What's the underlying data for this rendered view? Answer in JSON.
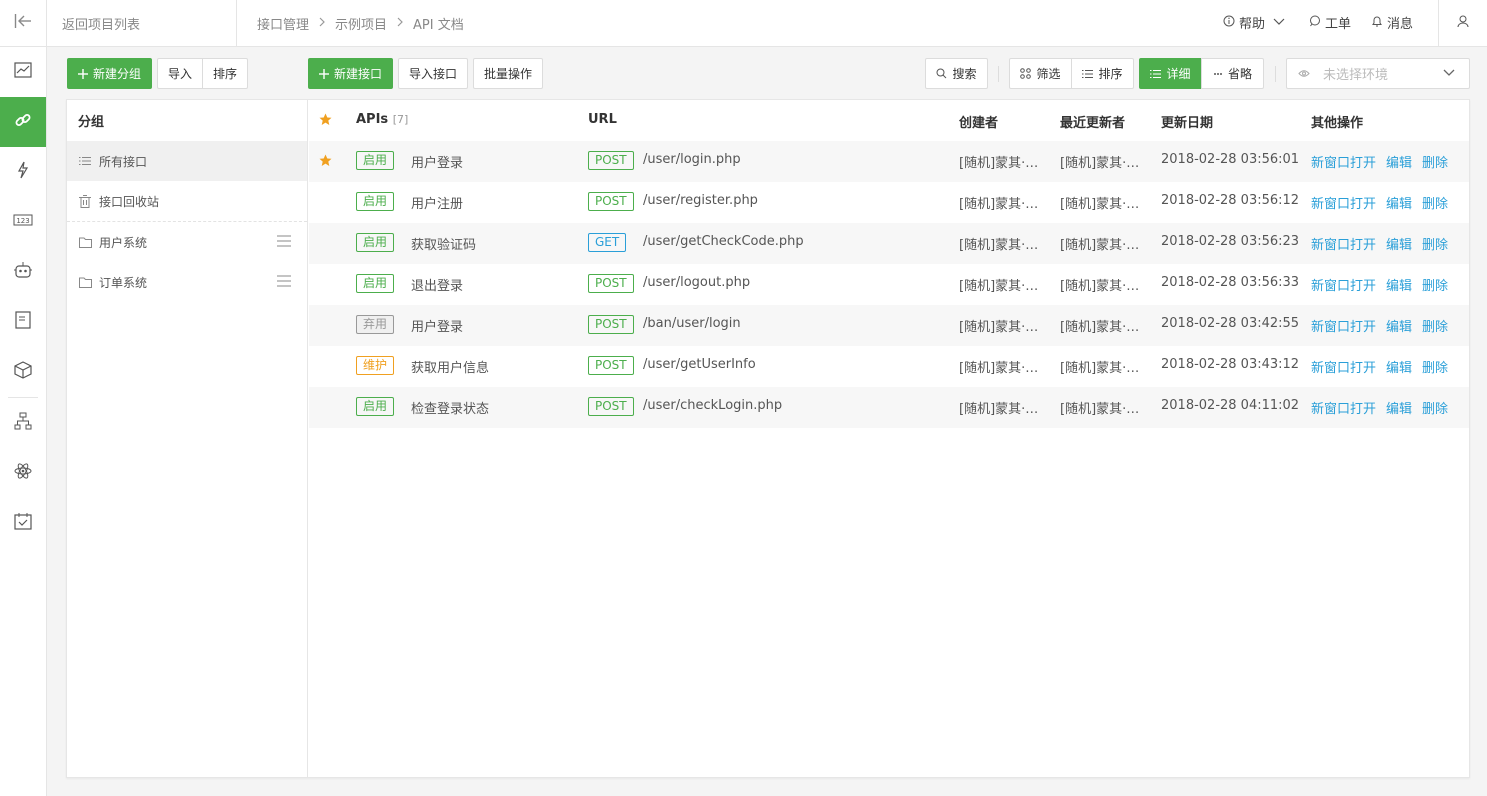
{
  "topbar": {
    "back_text": "返回项目列表",
    "breadcrumb": [
      "接口管理",
      "示例项目",
      "API 文档"
    ],
    "help": "帮助",
    "ticket": "工单",
    "messages": "消息"
  },
  "toolbar": {
    "new_group": "新建分组",
    "import": "导入",
    "sort": "排序",
    "new_api": "新建接口",
    "import_api": "导入接口",
    "batch": "批量操作",
    "search": "搜索",
    "filter": "筛选",
    "sort2": "排序",
    "detail": "详细",
    "brief": "省略",
    "env_placeholder": "未选择环境"
  },
  "groups": {
    "header": "分组",
    "items": [
      {
        "label": "所有接口",
        "icon": "list-icon"
      },
      {
        "label": "接口回收站",
        "icon": "trash-icon"
      },
      {
        "label": "用户系统",
        "icon": "folder-icon"
      },
      {
        "label": "订单系统",
        "icon": "folder-icon"
      }
    ]
  },
  "table": {
    "headers": {
      "apis": "APIs",
      "count": "[7]",
      "url": "URL",
      "creator": "创建者",
      "updater": "最近更新者",
      "date": "更新日期",
      "ops": "其他操作"
    },
    "ops_labels": {
      "open": "新窗口打开",
      "edit": "编辑",
      "delete": "删除"
    },
    "rows": [
      {
        "starred": true,
        "status": "启用",
        "status_type": "on",
        "name": "用户登录",
        "method": "POST",
        "url": "/user/login.php",
        "creator": "[随机]蒙其·D·路飞",
        "updater": "[随机]蒙其·D·路飞",
        "date": "2018-02-28 03:56:01"
      },
      {
        "starred": false,
        "status": "启用",
        "status_type": "on",
        "name": "用户注册",
        "method": "POST",
        "url": "/user/register.php",
        "creator": "[随机]蒙其·D·路飞",
        "updater": "[随机]蒙其·D·路飞",
        "date": "2018-02-28 03:56:12"
      },
      {
        "starred": false,
        "status": "启用",
        "status_type": "on",
        "name": "获取验证码",
        "method": "GET",
        "url": "/user/getCheckCode.php",
        "creator": "[随机]蒙其·D·路飞",
        "updater": "[随机]蒙其·D·路飞",
        "date": "2018-02-28 03:56:23"
      },
      {
        "starred": false,
        "status": "启用",
        "status_type": "on",
        "name": "退出登录",
        "method": "POST",
        "url": "/user/logout.php",
        "creator": "[随机]蒙其·D·路飞",
        "updater": "[随机]蒙其·D·路飞",
        "date": "2018-02-28 03:56:33"
      },
      {
        "starred": false,
        "status": "弃用",
        "status_type": "off",
        "name": "用户登录",
        "method": "POST",
        "url": "/ban/user/login",
        "creator": "[随机]蒙其·D·路飞",
        "updater": "[随机]蒙其·D·路飞",
        "date": "2018-02-28 03:42:55"
      },
      {
        "starred": false,
        "status": "维护",
        "status_type": "maint",
        "name": "获取用户信息",
        "method": "POST",
        "url": "/user/getUserInfo",
        "creator": "[随机]蒙其·D·路飞",
        "updater": "[随机]蒙其·D·路飞",
        "date": "2018-02-28 03:43:12"
      },
      {
        "starred": false,
        "status": "启用",
        "status_type": "on",
        "name": "检查登录状态",
        "method": "POST",
        "url": "/user/checkLogin.php",
        "creator": "[随机]蒙其·D·路飞",
        "updater": "[随机]蒙其·D·路飞",
        "date": "2018-02-28 04:11:02"
      }
    ]
  },
  "colors": {
    "accent": "#4cae4c",
    "link": "#2a9fd8",
    "star": "#f0a020",
    "maint": "#f0a020"
  }
}
